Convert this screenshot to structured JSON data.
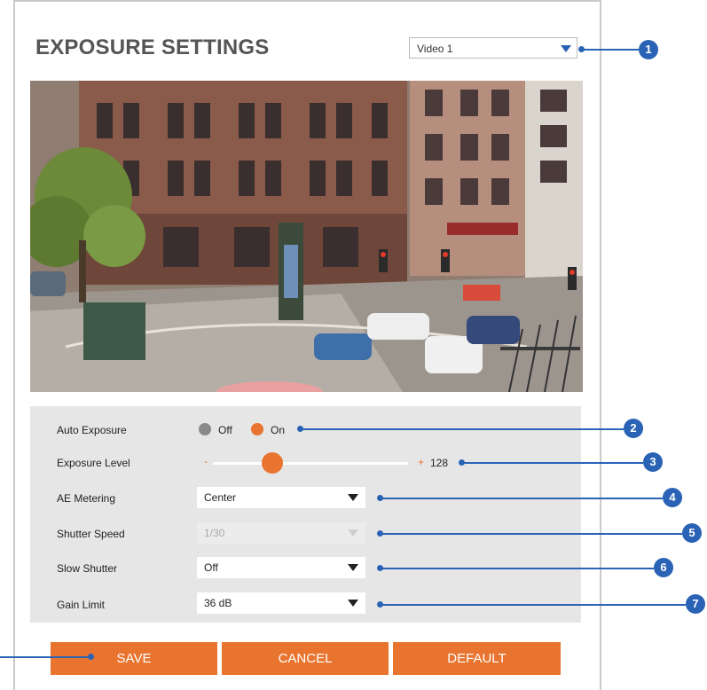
{
  "title": "EXPOSURE SETTINGS",
  "video_select": {
    "value": "Video 1"
  },
  "settings": {
    "auto_exposure": {
      "label": "Auto Exposure",
      "off": "Off",
      "on": "On",
      "selected": "On"
    },
    "exposure_level": {
      "label": "Exposure Level",
      "minus": "-",
      "plus": "+",
      "value": "128"
    },
    "ae_metering": {
      "label": "AE Metering",
      "value": "Center"
    },
    "shutter_speed": {
      "label": "Shutter Speed",
      "value": "1/30",
      "disabled": true
    },
    "slow_shutter": {
      "label": "Slow Shutter",
      "value": "Off"
    },
    "gain_limit": {
      "label": "Gain Limit",
      "value": "36 dB"
    }
  },
  "buttons": {
    "save": "SAVE",
    "cancel": "CANCEL",
    "default": "DEFAULT"
  },
  "callouts": [
    "1",
    "2",
    "3",
    "4",
    "5",
    "6",
    "7"
  ],
  "colors": {
    "accent": "#e8742f",
    "callout": "#2a63b5",
    "panel": "#e6e6e6"
  },
  "icons": {
    "dropdown": "triangle-down-icon",
    "radio": "radio-icon"
  }
}
